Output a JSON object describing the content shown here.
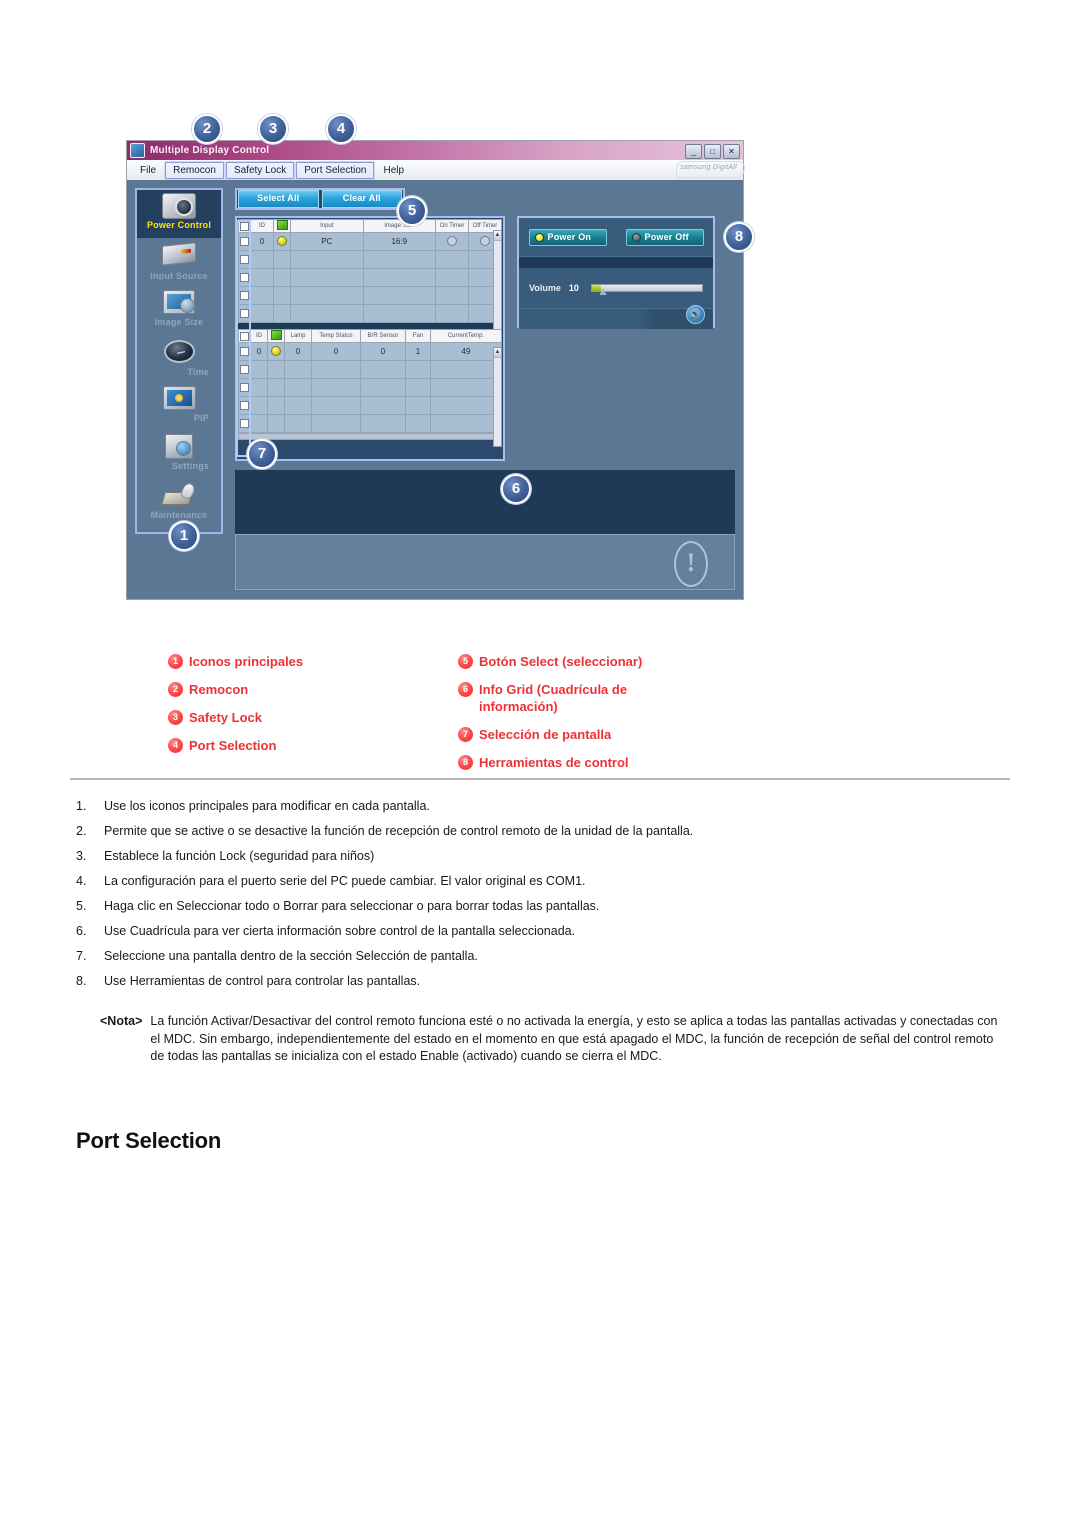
{
  "document": {
    "section_heading": "Port Selection"
  },
  "screenshot": {
    "window": {
      "title": "Multiple Display Control",
      "title_icon": "app-icon",
      "buttons": {
        "minimize": "_",
        "maximize": "□",
        "close": "✕"
      },
      "brand_logo": "samsung DigitAll"
    },
    "menubar": [
      {
        "label": "File",
        "boxed": false
      },
      {
        "label": "Remocon",
        "boxed": true
      },
      {
        "label": "Safety Lock",
        "boxed": true
      },
      {
        "label": "Port Selection",
        "boxed": true
      },
      {
        "label": "Help",
        "boxed": false
      }
    ],
    "sidebar": {
      "items": [
        {
          "label": "Power Control",
          "icon": "camera-icon",
          "active": true
        },
        {
          "label": "Input Source",
          "icon": "device-box-icon",
          "active": false
        },
        {
          "label": "Image Size",
          "icon": "monitor-magnifier-icon",
          "active": false
        },
        {
          "label": "Time",
          "icon": "clock-icon",
          "active": false
        },
        {
          "label": "PIP",
          "icon": "picture-in-picture-icon",
          "active": false
        },
        {
          "label": "Settings",
          "icon": "cube-gear-icon",
          "active": false
        },
        {
          "label": "Maintenance",
          "icon": "tools-icon",
          "active": false
        }
      ]
    },
    "select_buttons": {
      "select_all": "Select All",
      "clear_all": "Clear All"
    },
    "info_grid_top": {
      "columns": [
        "",
        "ID",
        "",
        "Input",
        "Image Size",
        "On Timer",
        "Off Timer"
      ],
      "rows": [
        {
          "checked": false,
          "id": "0",
          "power": "on",
          "input": "PC",
          "image_size": "16:9",
          "on_timer": "○",
          "off_timer": "○"
        },
        {
          "checked": false,
          "id": "",
          "power": "",
          "input": "",
          "image_size": "",
          "on_timer": "",
          "off_timer": ""
        },
        {
          "checked": false,
          "id": "",
          "power": "",
          "input": "",
          "image_size": "",
          "on_timer": "",
          "off_timer": ""
        },
        {
          "checked": false,
          "id": "",
          "power": "",
          "input": "",
          "image_size": "",
          "on_timer": "",
          "off_timer": ""
        },
        {
          "checked": false,
          "id": "",
          "power": "",
          "input": "",
          "image_size": "",
          "on_timer": "",
          "off_timer": ""
        }
      ]
    },
    "info_grid_bottom": {
      "columns": [
        "",
        "ID",
        "",
        "Lamp",
        "Temp Status",
        "B/R Sensor",
        "Fan",
        "CurrentTemp."
      ],
      "rows": [
        {
          "checked": false,
          "id": "0",
          "power": "on",
          "lamp": "0",
          "temp_status": "0",
          "br_sensor": "0",
          "fan": "1",
          "current_temp": "49"
        },
        {
          "checked": false,
          "id": "",
          "power": "",
          "lamp": "",
          "temp_status": "",
          "br_sensor": "",
          "fan": "",
          "current_temp": ""
        },
        {
          "checked": false,
          "id": "",
          "power": "",
          "lamp": "",
          "temp_status": "",
          "br_sensor": "",
          "fan": "",
          "current_temp": ""
        },
        {
          "checked": false,
          "id": "",
          "power": "",
          "lamp": "",
          "temp_status": "",
          "br_sensor": "",
          "fan": "",
          "current_temp": ""
        },
        {
          "checked": false,
          "id": "",
          "power": "",
          "lamp": "",
          "temp_status": "",
          "br_sensor": "",
          "fan": "",
          "current_temp": ""
        }
      ]
    },
    "control_tools": {
      "power_on": "Power On",
      "power_off": "Power Off",
      "volume_label": "Volume",
      "volume_value": "10",
      "mute_icon": "speaker-icon"
    },
    "callouts": [
      "1",
      "2",
      "3",
      "4",
      "5",
      "6",
      "7",
      "8"
    ]
  },
  "legend": {
    "left": [
      {
        "num": "1",
        "text": "Iconos principales"
      },
      {
        "num": "2",
        "text": "Remocon"
      },
      {
        "num": "3",
        "text": "Safety Lock"
      },
      {
        "num": "4",
        "text": "Port Selection"
      }
    ],
    "right": [
      {
        "num": "5",
        "text": "Botón Select (seleccionar)"
      },
      {
        "num": "6",
        "text": "Info Grid (Cuadrícula de información)"
      },
      {
        "num": "7",
        "text": "Selección de pantalla"
      },
      {
        "num": "8",
        "text": "Herramientas de control"
      }
    ]
  },
  "steps": [
    {
      "num": "1.",
      "text": "Use los iconos principales para modificar en cada pantalla."
    },
    {
      "num": "2.",
      "text": "Permite que se active o se desactive la función de recepción de control remoto de la unidad de la pantalla."
    },
    {
      "num": "3.",
      "text": "Establece la función Lock (seguridad para niños)"
    },
    {
      "num": "4.",
      "text": "La configuración para el puerto serie del PC puede cambiar. El valor original es COM1."
    },
    {
      "num": "5.",
      "text": "Haga clic en Seleccionar todo o Borrar para seleccionar o para borrar todas las pantallas."
    },
    {
      "num": "6.",
      "text": "Use Cuadrícula para ver cierta información sobre control de la pantalla seleccionada."
    },
    {
      "num": "7.",
      "text": "Seleccione una pantalla dentro de la sección Selección de pantalla."
    },
    {
      "num": "8.",
      "text": "Use Herramientas de control para controlar las pantallas."
    }
  ],
  "nota": {
    "label": "<Nota>",
    "body": "La función Activar/Desactivar del control remoto funciona esté o no activada la energía, y esto se aplica a todas las pantallas activadas y conectadas con el MDC. Sin embargo, independientemente del estado en el momento en que está apagado el MDC, la función de recepción de señal del control remoto de todas las pantallas se inicializa con el estado Enable (activado) cuando se cierra el MDC."
  },
  "colors": {
    "accent_red": "#ed3237",
    "callout_blue": "#3f5f99",
    "titlebar_magenta": "#a8407f",
    "app_bg": "#5b7793",
    "active_label_yellow": "#ffe400"
  }
}
